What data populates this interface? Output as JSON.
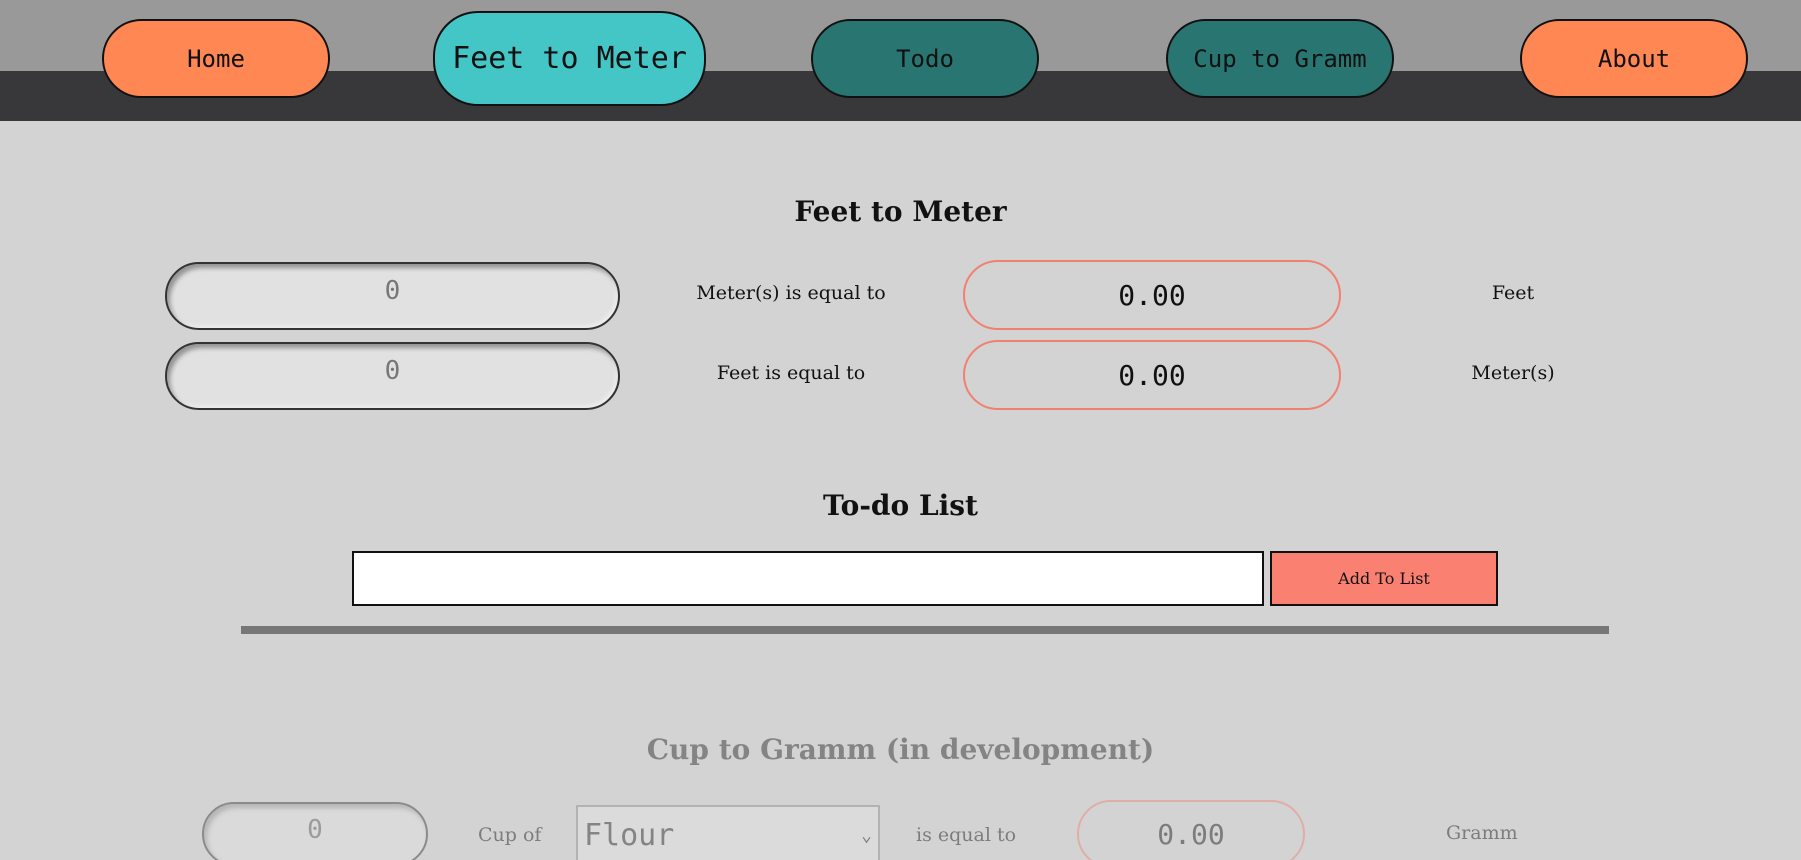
{
  "nav": {
    "home": "Home",
    "feet_to_meter": "Feet to Meter",
    "todo": "Todo",
    "cup_to_gramm": "Cup to Gramm",
    "about": "About"
  },
  "colors": {
    "header_top": "#999999",
    "header_bottom": "#38383b",
    "accent_orange": "#ff8754",
    "accent_cyan": "#45c6c6",
    "accent_teal": "#287572",
    "salmon": "#fa8072",
    "page_bg": "#d3d3d3"
  },
  "feet_to_meter": {
    "title": "Feet to Meter",
    "rows": [
      {
        "input_placeholder": "0",
        "label": "Meter(s) is equal to",
        "result": "0.00",
        "unit": "Feet"
      },
      {
        "input_placeholder": "0",
        "label": "Feet is equal to",
        "result": "0.00",
        "unit": "Meter(s)"
      }
    ]
  },
  "todo": {
    "title": "To-do List",
    "input_value": "",
    "add_button": "Add To List"
  },
  "cup_to_gramm": {
    "title": "Cup to Gramm (in development)",
    "input_placeholder": "0",
    "cup_of_label": "Cup of",
    "select_value": "Flour",
    "is_equal_label": "is equal to",
    "result": "0.00",
    "unit": "Gramm"
  }
}
